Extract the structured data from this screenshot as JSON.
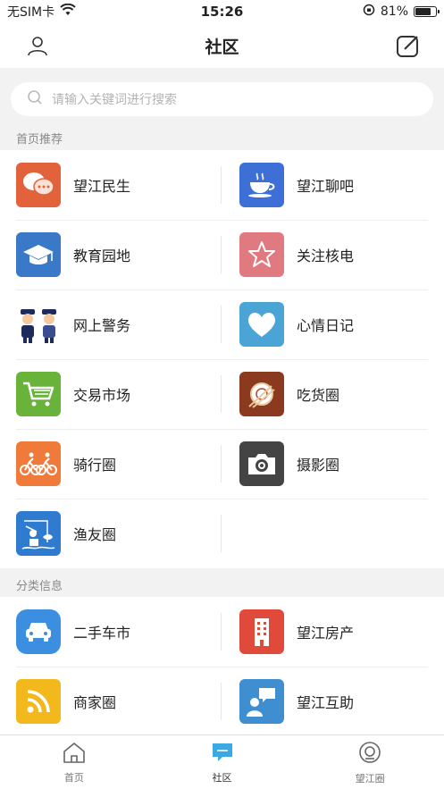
{
  "status": {
    "carrier": "无SIM卡",
    "time": "15:26",
    "battery": "81%",
    "battery_level": 0.81
  },
  "nav": {
    "title": "社区",
    "left_icon": "user-icon",
    "right_icon": "edit-icon"
  },
  "search": {
    "placeholder": "请输入关键词进行搜索"
  },
  "sections": {
    "recommend": {
      "title": "首页推荐",
      "items": [
        {
          "label": "望江民生",
          "icon": "chat-bubbles-icon",
          "color": "#e2623b"
        },
        {
          "label": "望江聊吧",
          "icon": "coffee-cup-icon",
          "color": "#3d6fd6"
        },
        {
          "label": "教育园地",
          "icon": "graduation-cap-icon",
          "color": "#3a78c8"
        },
        {
          "label": "关注核电",
          "icon": "star-icon",
          "color": "#e07a80"
        },
        {
          "label": "网上警务",
          "icon": "police-icon",
          "color": "#ffffff"
        },
        {
          "label": "心情日记",
          "icon": "heart-icon",
          "color": "#4aa5d6"
        },
        {
          "label": "交易市场",
          "icon": "shopping-cart-icon",
          "color": "#69b33a"
        },
        {
          "label": "吃货圈",
          "icon": "food-plate-icon",
          "color": "#8b3a1f"
        },
        {
          "label": "骑行圈",
          "icon": "cycling-icon",
          "color": "#f07a3a"
        },
        {
          "label": "摄影圈",
          "icon": "camera-icon",
          "color": "#444444"
        },
        {
          "label": "渔友圈",
          "icon": "fishing-icon",
          "color": "#2f7bd0"
        }
      ]
    },
    "classified": {
      "title": "分类信息",
      "items": [
        {
          "label": "二手车市",
          "icon": "car-icon",
          "color": "#3c8ee0"
        },
        {
          "label": "望江房产",
          "icon": "building-icon",
          "color": "#e04a3a"
        },
        {
          "label": "商家圈",
          "icon": "rss-icon",
          "color": "#f2b81c"
        },
        {
          "label": "望江互助",
          "icon": "help-person-icon",
          "color": "#3f8fd0"
        }
      ]
    }
  },
  "tabs": [
    {
      "label": "首页",
      "icon": "home-icon"
    },
    {
      "label": "社区",
      "icon": "community-chat-icon",
      "active": true
    },
    {
      "label": "望江圈",
      "icon": "circle-icon"
    }
  ]
}
